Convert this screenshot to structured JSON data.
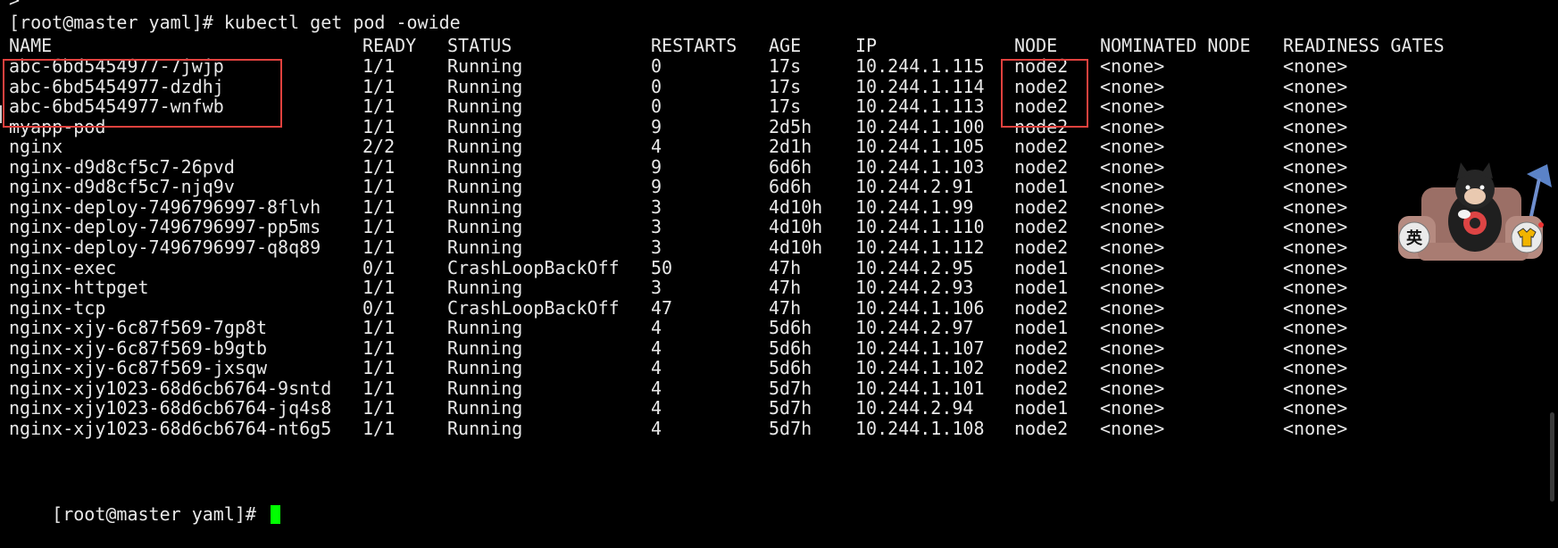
{
  "terminal": {
    "top_partial": ">",
    "command_line": "[root@master yaml]# kubectl get pod -owide",
    "prompt_final": "[root@master yaml]# ",
    "headers": [
      "NAME",
      "READY",
      "STATUS",
      "RESTARTS",
      "AGE",
      "IP",
      "NODE",
      "NOMINATED NODE",
      "READINESS GATES"
    ],
    "rows": [
      [
        "abc-6bd5454977-7jwjp",
        "1/1",
        "Running",
        "0",
        "17s",
        "10.244.1.115",
        "node2",
        "<none>",
        "<none>"
      ],
      [
        "abc-6bd5454977-dzdhj",
        "1/1",
        "Running",
        "0",
        "17s",
        "10.244.1.114",
        "node2",
        "<none>",
        "<none>"
      ],
      [
        "abc-6bd5454977-wnfwb",
        "1/1",
        "Running",
        "0",
        "17s",
        "10.244.1.113",
        "node2",
        "<none>",
        "<none>"
      ],
      [
        "myapp-pod",
        "1/1",
        "Running",
        "9",
        "2d5h",
        "10.244.1.100",
        "node2",
        "<none>",
        "<none>"
      ],
      [
        "nginx",
        "2/2",
        "Running",
        "4",
        "2d1h",
        "10.244.1.105",
        "node2",
        "<none>",
        "<none>"
      ],
      [
        "nginx-d9d8cf5c7-26pvd",
        "1/1",
        "Running",
        "9",
        "6d6h",
        "10.244.1.103",
        "node2",
        "<none>",
        "<none>"
      ],
      [
        "nginx-d9d8cf5c7-njq9v",
        "1/1",
        "Running",
        "9",
        "6d6h",
        "10.244.2.91",
        "node1",
        "<none>",
        "<none>"
      ],
      [
        "nginx-deploy-7496796997-8flvh",
        "1/1",
        "Running",
        "3",
        "4d10h",
        "10.244.1.99",
        "node2",
        "<none>",
        "<none>"
      ],
      [
        "nginx-deploy-7496796997-pp5ms",
        "1/1",
        "Running",
        "3",
        "4d10h",
        "10.244.1.110",
        "node2",
        "<none>",
        "<none>"
      ],
      [
        "nginx-deploy-7496796997-q8q89",
        "1/1",
        "Running",
        "3",
        "4d10h",
        "10.244.1.112",
        "node2",
        "<none>",
        "<none>"
      ],
      [
        "nginx-exec",
        "0/1",
        "CrashLoopBackOff",
        "50",
        "47h",
        "10.244.2.95",
        "node1",
        "<none>",
        "<none>"
      ],
      [
        "nginx-httpget",
        "1/1",
        "Running",
        "3",
        "47h",
        "10.244.2.93",
        "node1",
        "<none>",
        "<none>"
      ],
      [
        "nginx-tcp",
        "0/1",
        "CrashLoopBackOff",
        "47",
        "47h",
        "10.244.1.106",
        "node2",
        "<none>",
        "<none>"
      ],
      [
        "nginx-xjy-6c87f569-7gp8t",
        "1/1",
        "Running",
        "4",
        "5d6h",
        "10.244.2.97",
        "node1",
        "<none>",
        "<none>"
      ],
      [
        "nginx-xjy-6c87f569-b9gtb",
        "1/1",
        "Running",
        "4",
        "5d6h",
        "10.244.1.107",
        "node2",
        "<none>",
        "<none>"
      ],
      [
        "nginx-xjy-6c87f569-jxsqw",
        "1/1",
        "Running",
        "4",
        "5d6h",
        "10.244.1.102",
        "node2",
        "<none>",
        "<none>"
      ],
      [
        "nginx-xjy1023-68d6cb6764-9sntd",
        "1/1",
        "Running",
        "4",
        "5d7h",
        "10.244.1.101",
        "node2",
        "<none>",
        "<none>"
      ],
      [
        "nginx-xjy1023-68d6cb6764-jq4s8",
        "1/1",
        "Running",
        "4",
        "5d7h",
        "10.244.2.94",
        "node1",
        "<none>",
        "<none>"
      ],
      [
        "nginx-xjy1023-68d6cb6764-nt6g5",
        "1/1",
        "Running",
        "4",
        "5d7h",
        "10.244.1.108",
        "node2",
        "<none>",
        "<none>"
      ]
    ]
  },
  "widget": {
    "badge_left": "英",
    "badge_right_icon": "shirt-icon"
  },
  "colors": {
    "background": "#000000",
    "text": "#e8e8e8",
    "cursor": "#00ff00",
    "highlight": "#e0413e"
  }
}
